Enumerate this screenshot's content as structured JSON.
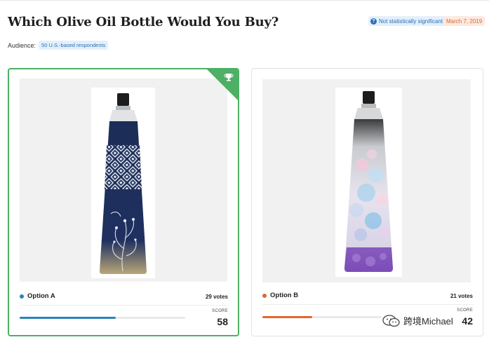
{
  "page": {
    "title": "Which Olive Oil Bottle Would You Buy?",
    "significance_badge": "Not statistically significant",
    "date_badge": "March 7, 2019",
    "audience_label": "Audience:",
    "audience_value": "50 U.S.-based respondents"
  },
  "options": [
    {
      "label": "Option A",
      "votes": "29 votes",
      "score_label": "SCORE",
      "score": "58",
      "score_fraction": 0.58,
      "color": "#2b82b8",
      "winner": true
    },
    {
      "label": "Option B",
      "votes": "21 votes",
      "score_label": "SCORE",
      "score": "42",
      "score_fraction": 0.42,
      "color": "#e0662f",
      "winner": false
    }
  ],
  "colors": {
    "winner_green": "#4cb065",
    "info_blue": "#2a6fb5",
    "date_orange": "#e0662f"
  },
  "watermark": {
    "text": "跨境Michael",
    "icon": "wechat-logo-icon"
  }
}
